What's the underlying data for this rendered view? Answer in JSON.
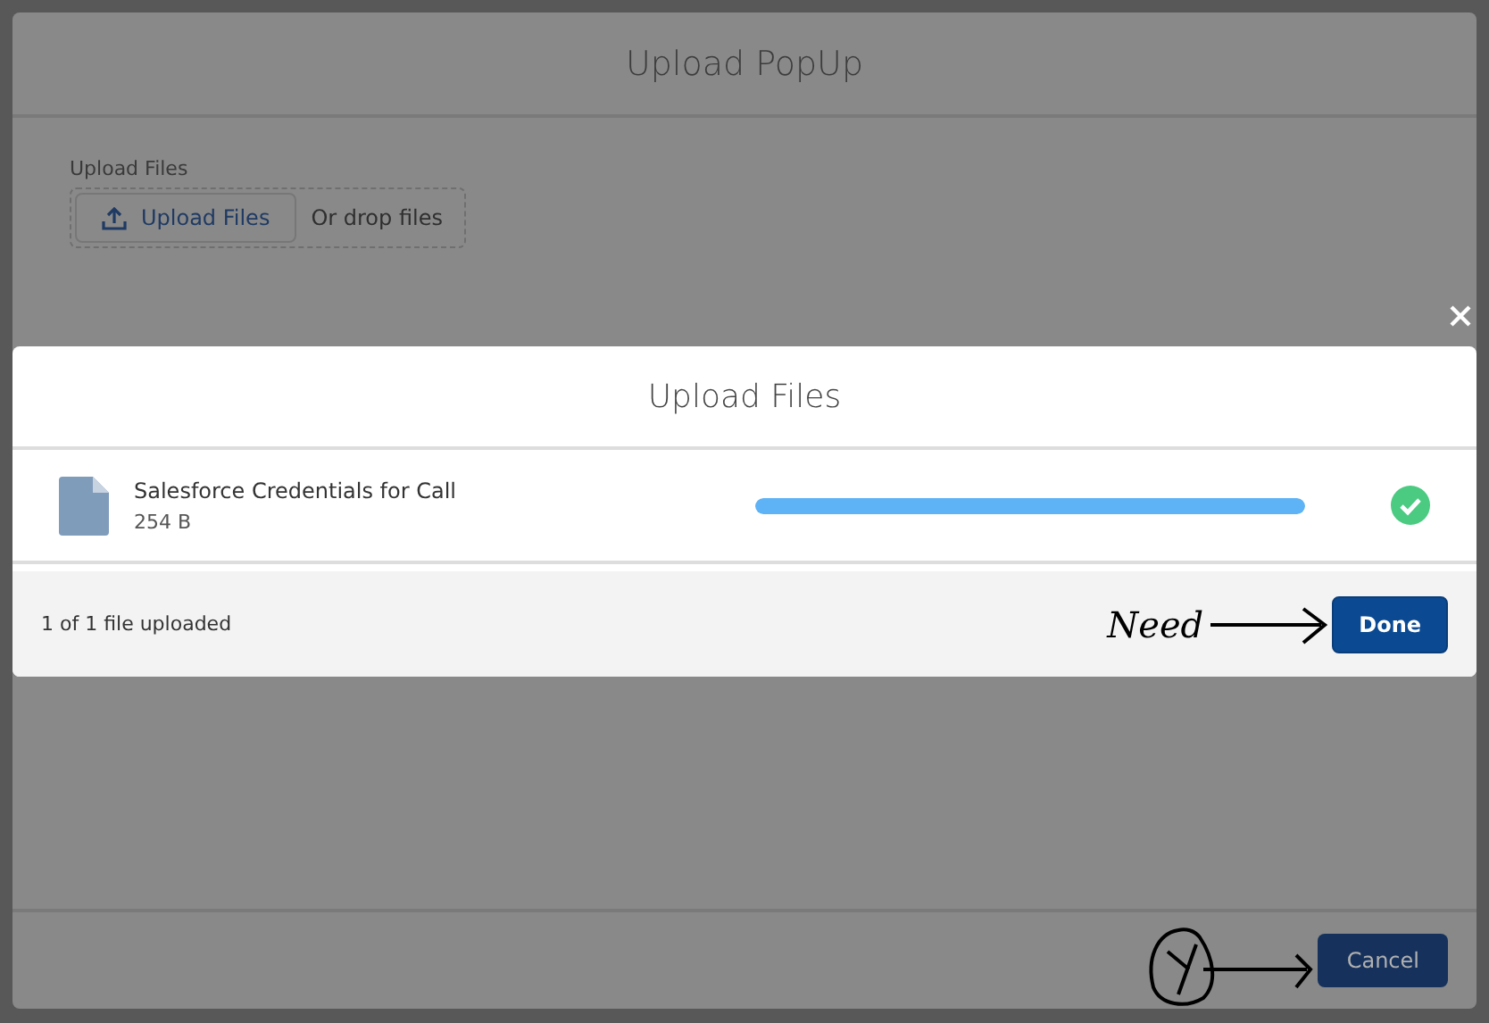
{
  "popup": {
    "title": "Upload PopUp",
    "upload_label": "Upload Files",
    "upload_button": "Upload Files",
    "drop_hint": "Or drop files",
    "cancel_button": "Cancel"
  },
  "upload_dialog": {
    "title": "Upload Files",
    "files": [
      {
        "name": "Salesforce Credentials for Call",
        "size": "254 B",
        "level": 1,
        "complete": true
      }
    ],
    "status": "1 of 1 file uploaded",
    "done_button": "Done"
  },
  "annotation": {
    "text": "Need"
  }
}
